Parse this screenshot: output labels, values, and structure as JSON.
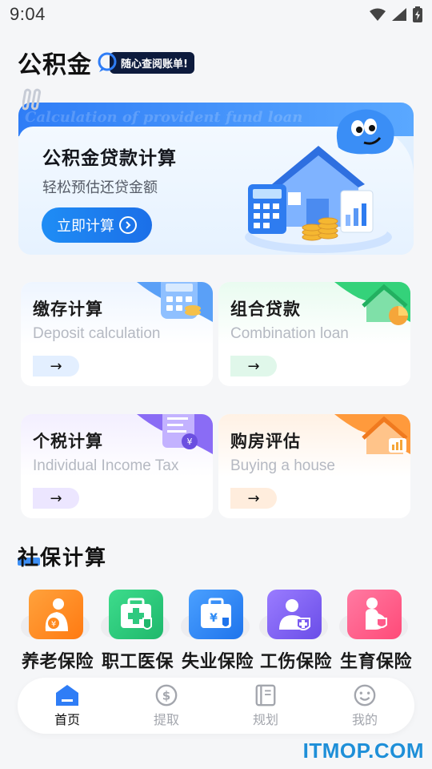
{
  "status_bar": {
    "time": "9:04"
  },
  "header": {
    "app_title": "公积金",
    "tagline": "随心查阅账单!"
  },
  "hero": {
    "bg_text": "Calculation of provident fund loan",
    "title": "公积金贷款计算",
    "subtitle": "轻松预估还贷金额",
    "button_label": "立即计算"
  },
  "cards": [
    {
      "title": "缴存计算",
      "subtitle": "Deposit calculation",
      "arrow": "→",
      "accent": "#5aa0f7"
    },
    {
      "title": "组合贷款",
      "subtitle": "Combination loan",
      "arrow": "→",
      "accent": "#34d27a"
    },
    {
      "title": "个税计算",
      "subtitle": "Individual Income Tax",
      "arrow": "→",
      "accent": "#8a6cf5"
    },
    {
      "title": "购房评估",
      "subtitle": "Buying a house",
      "arrow": "→",
      "accent": "#ff9a3c"
    }
  ],
  "section": {
    "title": "社保计算"
  },
  "insurance": [
    {
      "label": "养老保险",
      "icon": "elderly-icon",
      "color": "#ff8a1f"
    },
    {
      "label": "职工医保",
      "icon": "medical-kit-icon",
      "color": "#2fc97f"
    },
    {
      "label": "失业保险",
      "icon": "briefcase-icon",
      "color": "#2e8bf5"
    },
    {
      "label": "工伤保险",
      "icon": "injured-worker-icon",
      "color": "#7b5cf0"
    },
    {
      "label": "生育保险",
      "icon": "pregnant-icon",
      "color": "#ff5a8a"
    }
  ],
  "bottom_nav": [
    {
      "label": "首页",
      "icon": "home-icon",
      "active": true
    },
    {
      "label": "提取",
      "icon": "dollar-icon",
      "active": false
    },
    {
      "label": "规划",
      "icon": "notebook-icon",
      "active": false
    },
    {
      "label": "我的",
      "icon": "smiley-icon",
      "active": false
    }
  ],
  "watermark": "ITMOP.COM"
}
